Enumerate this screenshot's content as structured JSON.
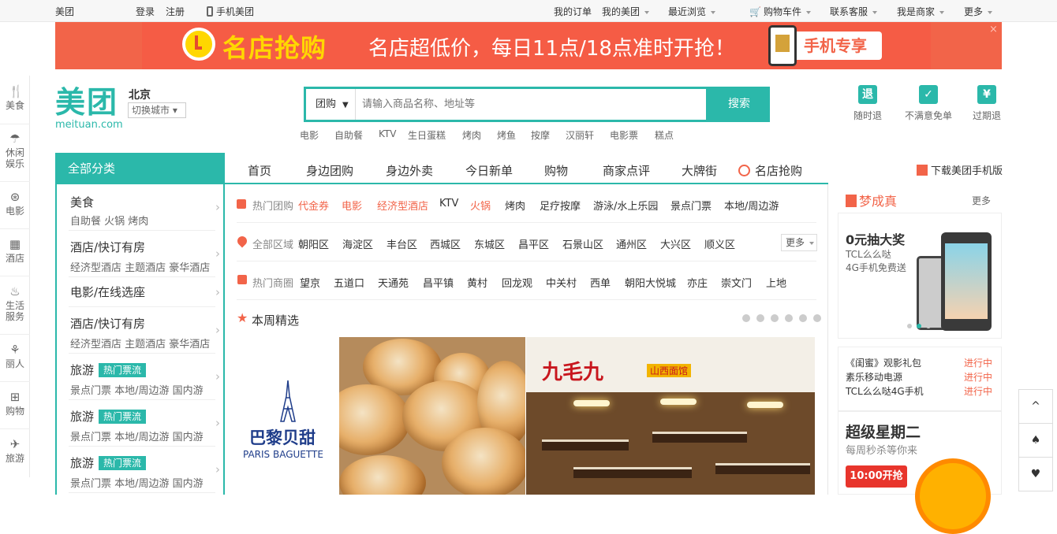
{
  "topbar": {
    "site": "美团",
    "login": "登录",
    "register": "注册",
    "mobile": "手机美团",
    "my_orders": "我的订单",
    "my_meituan": "我的美团",
    "recent": "最近浏览",
    "cart": "购物车件",
    "service": "联系客服",
    "merchant": "我是商家",
    "more": "更多"
  },
  "banner": {
    "brand": "名店抢购",
    "slogan": "名店超低价，每日11点/18点准时开抢！",
    "cta": "手机专享",
    "close": "×"
  },
  "leftrail": [
    {
      "icon": "fork-knife-icon",
      "glyph": "🍴",
      "label": "美食"
    },
    {
      "icon": "leisure-icon",
      "glyph": "☂",
      "label": "休闲\n娱乐"
    },
    {
      "icon": "film-reel-icon",
      "glyph": "⊛",
      "label": "电影"
    },
    {
      "icon": "building-icon",
      "glyph": "▦",
      "label": "酒店"
    },
    {
      "icon": "service-icon",
      "glyph": "♨",
      "label": "生活\n服务"
    },
    {
      "icon": "beauty-icon",
      "glyph": "⚘",
      "label": "丽人"
    },
    {
      "icon": "basket-icon",
      "glyph": "⊞",
      "label": "购物"
    },
    {
      "icon": "plane-icon",
      "glyph": "✈",
      "label": "旅游"
    }
  ],
  "logo": {
    "text": "美团",
    "sub": "meituan.com"
  },
  "city": {
    "name": "北京",
    "switch": "切换城市 ▾"
  },
  "search": {
    "category": "团购",
    "placeholder": "请输入商品名称、地址等",
    "button": "搜索",
    "hotwords": [
      "电影",
      "自助餐",
      "KTV",
      "生日蛋糕",
      "烤肉",
      "烤鱼",
      "按摩",
      "汉丽轩",
      "电影票",
      "糕点"
    ]
  },
  "guarantees": [
    {
      "icon": "refund-anytime-icon",
      "glyph": "退",
      "label": "随时退"
    },
    {
      "icon": "check-icon",
      "glyph": "✓",
      "label": "不满意免单"
    },
    {
      "icon": "expired-refund-icon",
      "glyph": "¥",
      "label": "过期退"
    }
  ],
  "nav": {
    "all_categories": "全部分类",
    "items": [
      "首页",
      "身边团购",
      "身边外卖",
      "今日新单",
      "购物",
      "商家点评",
      "大牌街",
      "名店抢购"
    ],
    "download": "下载美团手机版"
  },
  "categories": [
    {
      "title": "美食",
      "sub": "自助餐  火锅  烤肉"
    },
    {
      "title": "酒店/快订有房",
      "sub": "经济型酒店  主题酒店  豪华酒店"
    },
    {
      "title": "电影/在线选座",
      "sub": ""
    },
    {
      "title": "酒店/快订有房",
      "sub": "经济型酒店  主题酒店  豪华酒店"
    },
    {
      "title": "旅游",
      "tag": "热门票流",
      "sub": "景点门票  本地/周边游  国内游"
    },
    {
      "title": "旅游",
      "tag": "热门票流",
      "sub": "景点门票  本地/周边游  国内游"
    },
    {
      "title": "旅游",
      "tag": "热门票流",
      "sub": "景点门票  本地/周边游  国内游"
    }
  ],
  "filters": {
    "hot_label": "热门团购",
    "hot": [
      "代金券",
      "电影",
      "经济型酒店",
      "KTV",
      "火锅",
      "烤肉",
      "足疗按摩",
      "游泳/水上乐园",
      "景点门票",
      "本地/周边游"
    ],
    "area_label": "全部区域",
    "areas": [
      "朝阳区",
      "海淀区",
      "丰台区",
      "西城区",
      "东城区",
      "昌平区",
      "石景山区",
      "通州区",
      "大兴区",
      "顺义区"
    ],
    "area_more": "更多",
    "district_label": "热门商圈",
    "districts": [
      "望京",
      "五道口",
      "天通苑",
      "昌平镇",
      "黄村",
      "回龙观",
      "中关村",
      "西单",
      "朝阳大悦城",
      "亦庄",
      "崇文门",
      "上地"
    ]
  },
  "weekly": {
    "title": "本周精选",
    "dots": 6
  },
  "deals": {
    "d1_cn": "巴黎贝甜",
    "d1_en": "PARIS BAGUETTE",
    "d3_logo": "九毛九",
    "d3_tag": "山西面馆"
  },
  "right": {
    "dream_title": "梦成真",
    "dream_more": "更多",
    "promo_title": "0元抽大奖",
    "promo_line1": "TCL么么哒",
    "promo_line2": "4G手机免费送",
    "activities": [
      {
        "name": "《闺蜜》观影礼包",
        "status": "进行中"
      },
      {
        "name": "素乐移动电源",
        "status": "进行中"
      },
      {
        "name": "TCL么么哒4G手机",
        "status": "进行中"
      }
    ],
    "super_title": "超级星期二",
    "super_sub": "每周秒杀等你来",
    "super_btn": "10:00开抢"
  },
  "tools": {
    "top": "^",
    "fav": "♠",
    "heart": "♥"
  }
}
